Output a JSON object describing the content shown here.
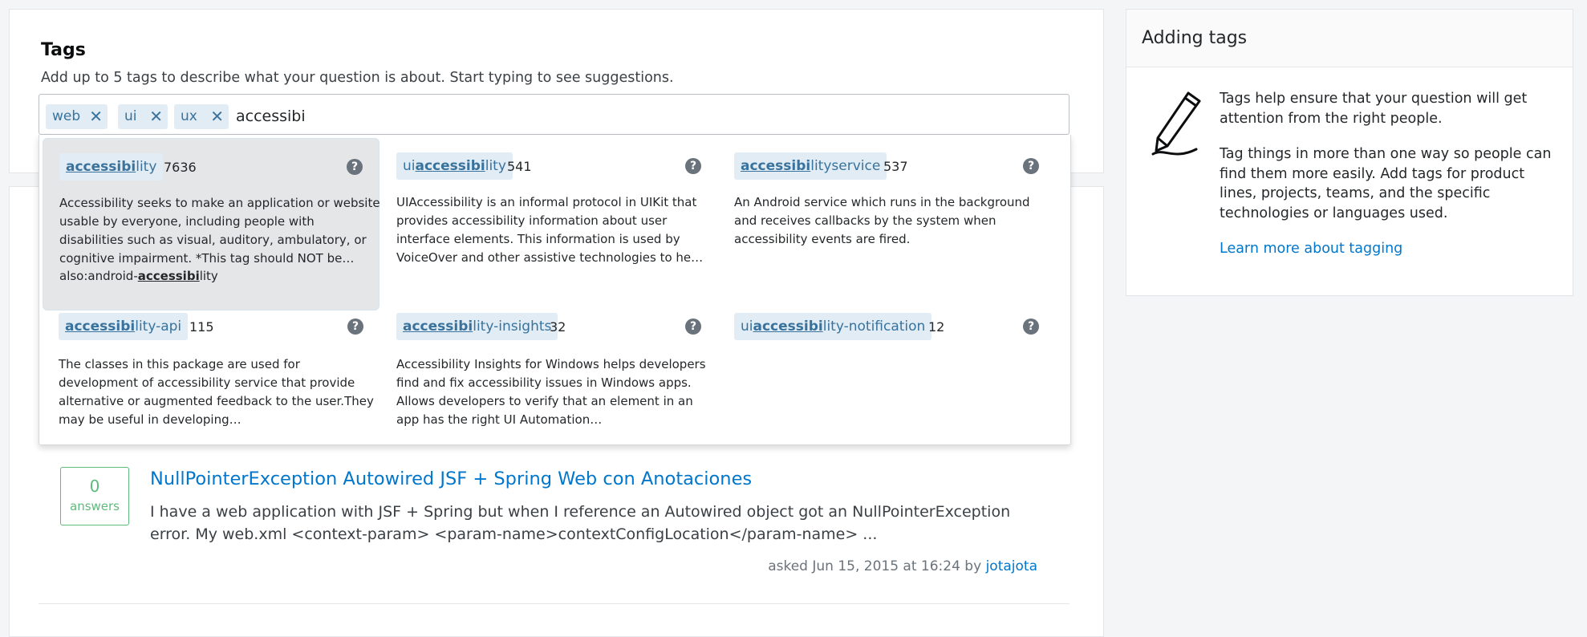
{
  "tags_section": {
    "title": "Tags",
    "description": "Add up to 5 tags to describe what your question is about. Start typing to see suggestions.",
    "selected_tags": [
      "web",
      "ui",
      "ux"
    ],
    "remove_icon": "close-icon",
    "input_value": "accessibi"
  },
  "suggestions": [
    {
      "prefix": "",
      "match": "accessibi",
      "suffix": "lity",
      "count": "7636",
      "help": "?",
      "desc": "Accessibility seeks to make an application or website usable by everyone, including people with disabilities such as visual, auditory, ambulatory, or cognitive impairment. *This tag should NOT be…",
      "also_prefix": "also:android-",
      "also_match": "accessibi",
      "also_suffix": "lity"
    },
    {
      "prefix": "ui",
      "match": "accessibi",
      "suffix": "lity",
      "count": "541",
      "help": "?",
      "desc": "UIAccessibility is an informal protocol in UIKit that provides accessibility information about user interface elements. This information is used by VoiceOver and other assistive technologies to he…"
    },
    {
      "prefix": "",
      "match": "accessibi",
      "suffix": "lityservice",
      "count": "537",
      "help": "?",
      "desc": "An Android service which runs in the background and receives callbacks by the system when accessibility events are fired."
    },
    {
      "prefix": "",
      "match": "accessibi",
      "suffix": "lity-api",
      "count": "115",
      "help": "?",
      "desc": "The classes in this package are used for development of accessibility service that provide alternative or augmented feedback to the user.They may be useful in developing…"
    },
    {
      "prefix": "",
      "match": "accessibi",
      "suffix": "lity-insights",
      "count": "32",
      "help": "?",
      "desc": "Accessibility Insights for Windows helps developers find and fix accessibility issues in Windows apps. Allows developers to verify that an element in an app has the right UI Automation…"
    },
    {
      "prefix": "ui",
      "match": "accessibi",
      "suffix": "lity-notification",
      "count": "12",
      "help": "?",
      "desc": ""
    }
  ],
  "question": {
    "answer_count": "0",
    "answer_label": "answers",
    "title": "NullPointerException Autowired JSF + Spring Web con Anotaciones",
    "excerpt": "I have a web application with JSF + Spring but when I reference an Autowired object got an NullPointerException error. My web.xml <context-param> <param-name>contextConfigLocation</param-name> ...",
    "asked": "asked Jun 15, 2015 at 16:24 by",
    "user": "jotajota"
  },
  "sidebar": {
    "title": "Adding tags",
    "icon": "pencil-icon",
    "para1": "Tags help ensure that your question will get attention from the right people.",
    "para2": "Tag things in more than one way so people can find them more easily. Add tags for product lines, projects, teams, and the specific technologies or languages used.",
    "link": "Learn more about tagging"
  },
  "colors": {
    "tag_bg": "#e1ecf4",
    "tag_text": "#39739d",
    "link": "#0077cc",
    "answers_green": "#5eba7d",
    "active_suggestion_bg": "#e4e6e8"
  }
}
